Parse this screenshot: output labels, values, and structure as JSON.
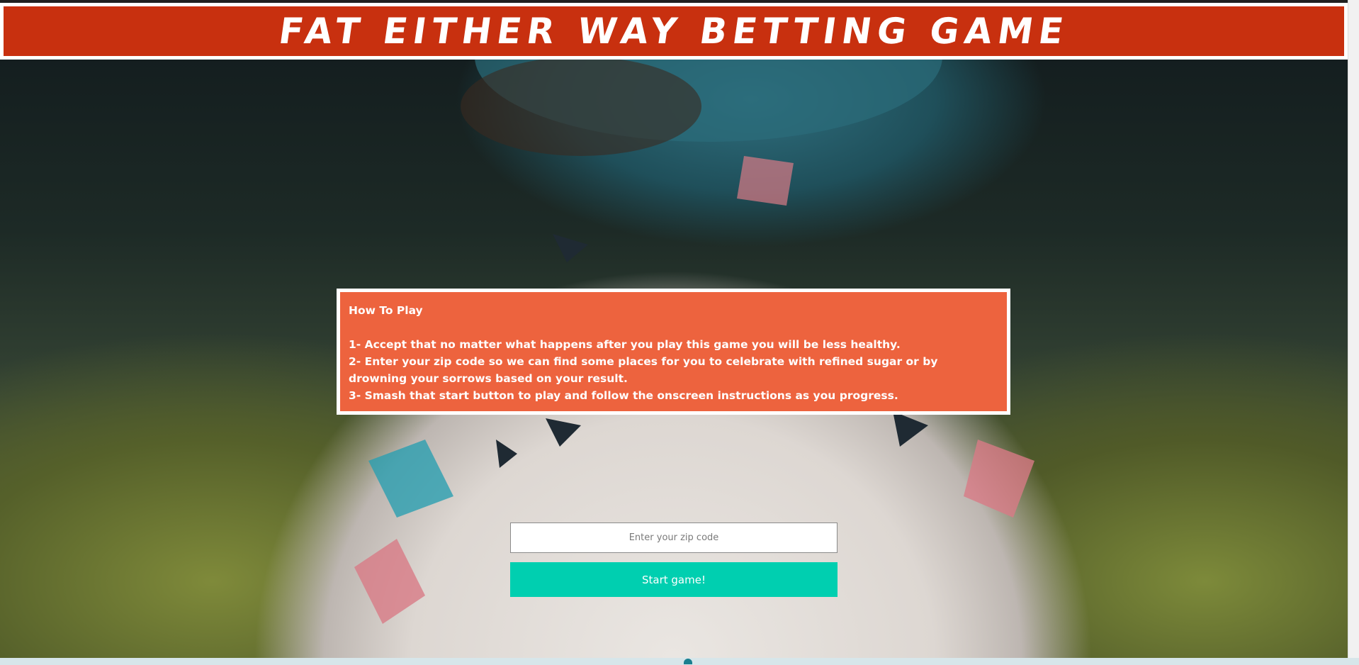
{
  "header": {
    "title": "Fat Either Way Betting Game"
  },
  "how_to_play": {
    "heading": "How To Play",
    "steps": [
      "1- Accept that no matter what happens after you play this game you will be less healthy.",
      "2- Enter your zip code so we can find some places for you to celebrate with refined sugar or by drowning your sorrows based on your result.",
      "3- Smash that start button to play and follow the onscreen instructions as you progress."
    ]
  },
  "form": {
    "zip_placeholder": "Enter your zip code",
    "zip_value": "",
    "start_label": "Start game!"
  },
  "colors": {
    "header_red": "#c8300f",
    "box_orange": "#eb4d23",
    "button_teal": "#00cfb0"
  }
}
